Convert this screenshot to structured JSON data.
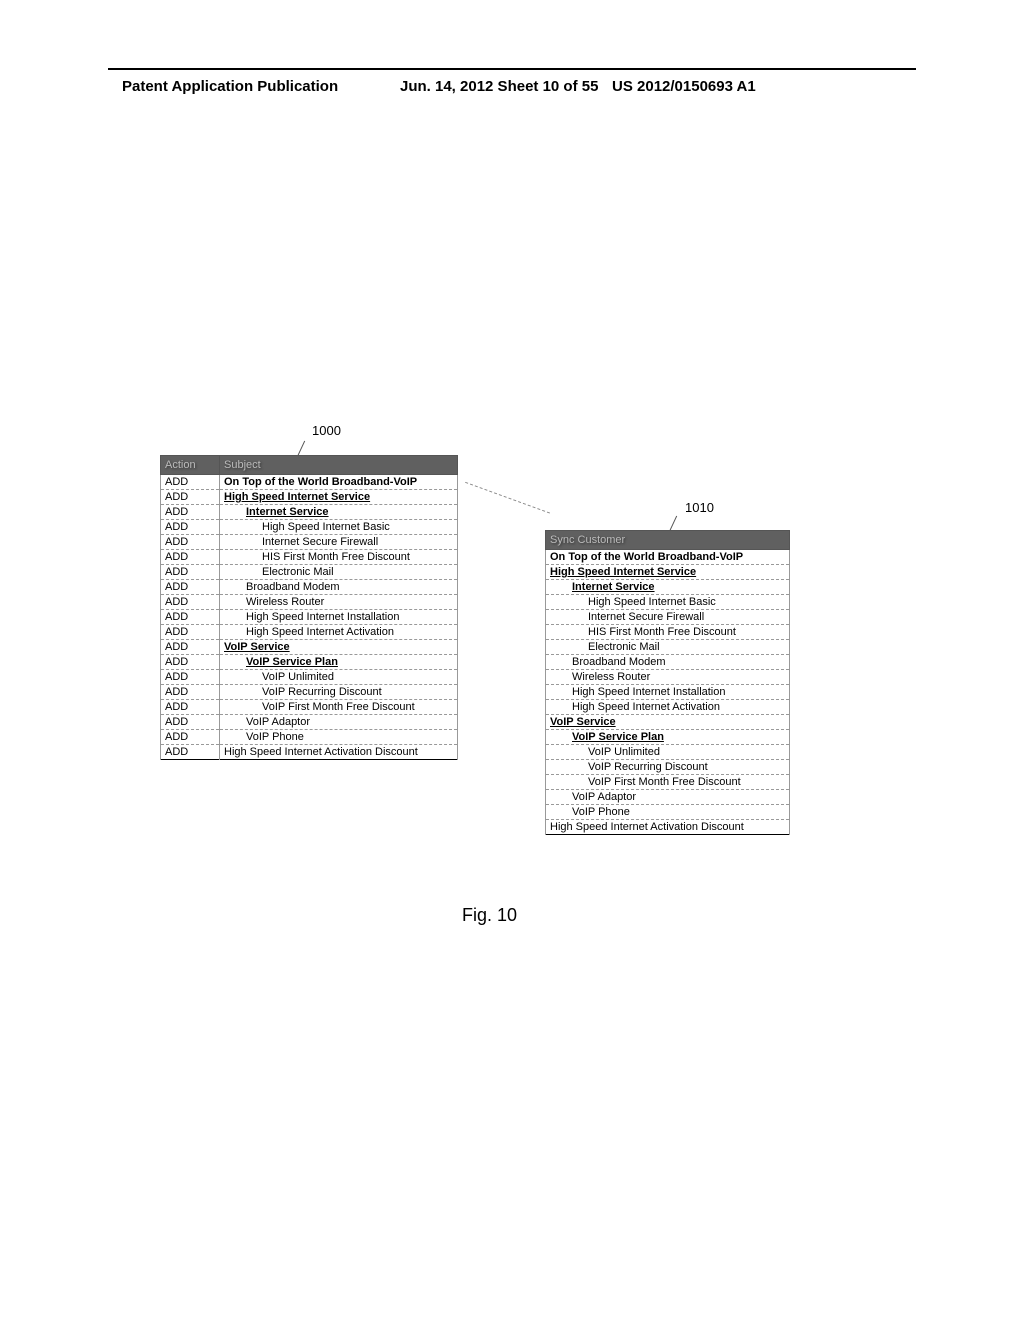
{
  "header": {
    "left": "Patent Application Publication",
    "center": "Jun. 14, 2012  Sheet 10 of 55",
    "right": "US 2012/0150693 A1"
  },
  "refs": {
    "left_table": "1000",
    "right_table": "1010"
  },
  "left_table": {
    "headers": {
      "action": "Action",
      "subject": "Subject"
    },
    "rows": [
      {
        "action": "ADD",
        "subject": "On Top of the World Broadband-VoIP",
        "bold": true
      },
      {
        "action": "ADD",
        "subject": "High Speed Internet Service",
        "bold": true,
        "underline": true
      },
      {
        "action": "ADD",
        "subject": "Internet Service",
        "bold": true,
        "underline": true,
        "indent": 1
      },
      {
        "action": "ADD",
        "subject": "High Speed Internet Basic",
        "indent": 2
      },
      {
        "action": "ADD",
        "subject": "Internet Secure Firewall",
        "indent": 2
      },
      {
        "action": "ADD",
        "subject": "HIS First Month Free Discount",
        "indent": 2
      },
      {
        "action": "ADD",
        "subject": "Electronic Mail",
        "indent": 2
      },
      {
        "action": "ADD",
        "subject": "Broadband Modem",
        "indent": 1
      },
      {
        "action": "ADD",
        "subject": "Wireless Router",
        "indent": 1
      },
      {
        "action": "ADD",
        "subject": "High Speed Internet Installation",
        "indent": 1
      },
      {
        "action": "ADD",
        "subject": "High Speed Internet Activation",
        "indent": 1
      },
      {
        "action": "ADD",
        "subject": "VoIP Service",
        "bold": true,
        "underline": true
      },
      {
        "action": "ADD",
        "subject": "VoIP Service Plan",
        "bold": true,
        "underline": true,
        "indent": 1
      },
      {
        "action": "ADD",
        "subject": "VoIP Unlimited",
        "indent": 2
      },
      {
        "action": "ADD",
        "subject": "VoIP Recurring Discount",
        "indent": 2
      },
      {
        "action": "ADD",
        "subject": "VoIP First Month Free Discount",
        "indent": 2
      },
      {
        "action": "ADD",
        "subject": "VoIP Adaptor",
        "indent": 1
      },
      {
        "action": "ADD",
        "subject": "VoIP Phone",
        "indent": 1
      },
      {
        "action": "ADD",
        "subject": "High Speed Internet Activation Discount"
      }
    ]
  },
  "right_table": {
    "header": "Sync Customer",
    "rows": [
      {
        "subject": "On Top of the World Broadband-VoIP",
        "bold": true
      },
      {
        "subject": "High Speed Internet Service",
        "bold": true,
        "underline": true
      },
      {
        "subject": "Internet Service",
        "bold": true,
        "underline": true,
        "indent": 1
      },
      {
        "subject": "High Speed Internet Basic",
        "indent": 2
      },
      {
        "subject": "Internet Secure Firewall",
        "indent": 2
      },
      {
        "subject": "HIS First Month Free Discount",
        "indent": 2
      },
      {
        "subject": "Electronic Mail",
        "indent": 2
      },
      {
        "subject": "Broadband Modem",
        "indent": 1
      },
      {
        "subject": "Wireless Router",
        "indent": 1
      },
      {
        "subject": "High Speed Internet Installation",
        "indent": 1
      },
      {
        "subject": "High Speed Internet Activation",
        "indent": 1
      },
      {
        "subject": "VoIP Service",
        "bold": true,
        "underline": true
      },
      {
        "subject": "VoIP Service Plan",
        "bold": true,
        "underline": true,
        "indent": 1
      },
      {
        "subject": "VoIP Unlimited",
        "indent": 2
      },
      {
        "subject": "VoIP Recurring Discount",
        "indent": 2
      },
      {
        "subject": "VoIP First Month Free Discount",
        "indent": 2
      },
      {
        "subject": "VoIP Adaptor",
        "indent": 1
      },
      {
        "subject": "VoIP Phone",
        "indent": 1
      },
      {
        "subject": "High Speed Internet Activation Discount"
      }
    ]
  },
  "figure_caption": "Fig. 10"
}
